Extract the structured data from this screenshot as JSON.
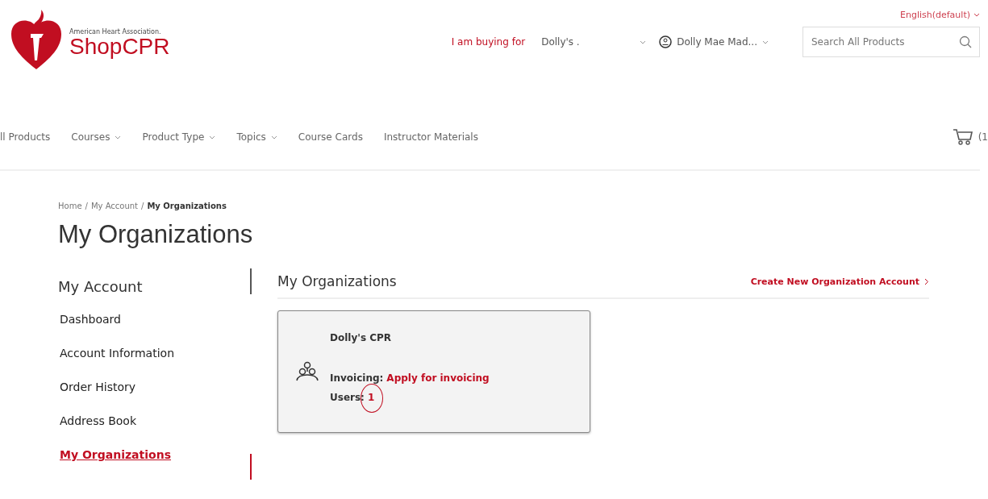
{
  "header": {
    "logo_tagline": "American Heart Association.",
    "logo_name": "ShopCPR",
    "language": "English(default)",
    "buying_for_label": "I am buying for",
    "buying_for_value": "Dolly's .",
    "account_name": "Dolly Mae Mad...",
    "search": {
      "placeholder": "Search All Products"
    }
  },
  "nav": {
    "items": [
      {
        "label": "ll Products",
        "has_menu": false
      },
      {
        "label": "Courses",
        "has_menu": true
      },
      {
        "label": "Product Type",
        "has_menu": true
      },
      {
        "label": "Topics",
        "has_menu": true
      },
      {
        "label": "Course Cards",
        "has_menu": false
      },
      {
        "label": "Instructor Materials",
        "has_menu": false
      }
    ],
    "cart_count": "(1"
  },
  "breadcrumb": [
    {
      "label": "Home",
      "current": false
    },
    {
      "separator": "/",
      "label": "My Account",
      "current": false
    },
    {
      "separator": "/",
      "label": "My Organizations",
      "current": true
    }
  ],
  "page_title": "My Organizations",
  "sidebar": {
    "title": "My Account",
    "items": [
      {
        "label": "Dashboard",
        "selected": false
      },
      {
        "label": "Account Information",
        "selected": false
      },
      {
        "label": "Order History",
        "selected": false
      },
      {
        "label": "Address Book",
        "selected": false
      },
      {
        "label": "My Organizations",
        "selected": true
      }
    ]
  },
  "content": {
    "title": "My Organizations",
    "create_link": "Create New Organization Account",
    "organizations": [
      {
        "name": "Dolly's CPR",
        "invoicing_label": "Invoicing:",
        "invoicing_value": "Apply for invoicing",
        "users_label": "Users:",
        "users_value": "1",
        "users_highlighted": true
      }
    ]
  }
}
